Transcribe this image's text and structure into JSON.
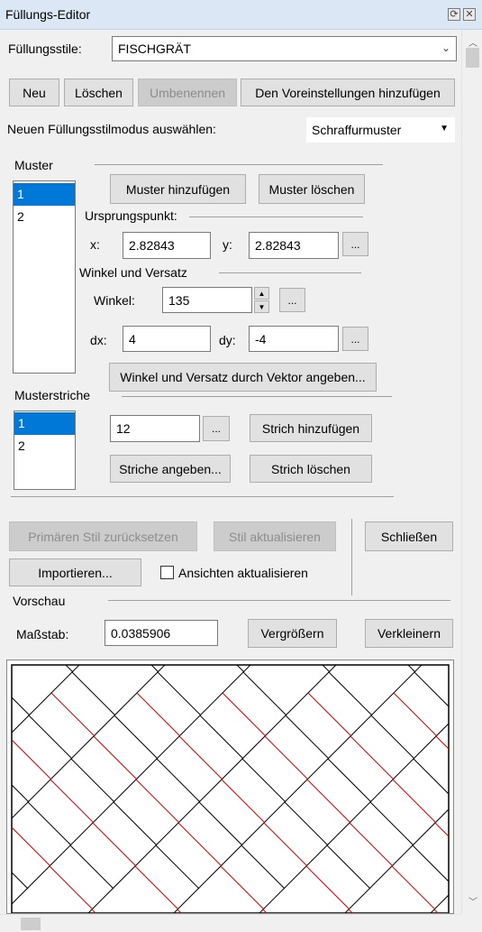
{
  "window": {
    "title": "Füllungs-Editor"
  },
  "fill_styles": {
    "label": "Füllungsstile:",
    "selected": "FISCHGRÄT"
  },
  "actions": {
    "new": "Neu",
    "delete": "Löschen",
    "rename": "Umbenennen",
    "add_preset": "Den Voreinstellungen hinzufügen"
  },
  "mode": {
    "label": "Neuen Füllungsstilmodus auswählen:",
    "selected": "Schraffurmuster"
  },
  "pattern": {
    "heading": "Muster",
    "items": [
      "1",
      "2"
    ],
    "selected_index": 0,
    "add_button": "Muster hinzufügen",
    "delete_button": "Muster löschen",
    "origin_heading": "Ursprungspunkt:",
    "x_label": "x:",
    "x_value": "2.82843",
    "y_label": "y:",
    "y_value": "2.82843",
    "angle_heading": "Winkel und Versatz",
    "angle_label": "Winkel:",
    "angle_value": "135",
    "dx_label": "dx:",
    "dx_value": "4",
    "dy_label": "dy:",
    "dy_value": "-4",
    "vector_button": "Winkel und Versatz durch Vektor angeben...",
    "ellipsis": "..."
  },
  "strokes": {
    "heading": "Musterstriche",
    "items": [
      "1",
      "2"
    ],
    "selected_index": 0,
    "value": "12",
    "add_button": "Strich hinzufügen",
    "specify_button": "Striche angeben...",
    "delete_button": "Strich löschen"
  },
  "bottom": {
    "reset_button": "Primären Stil zurücksetzen",
    "update_button": "Stil aktualisieren",
    "close_button": "Schließen",
    "import_button": "Importieren...",
    "update_views_label": "Ansichten aktualisieren",
    "update_views_checked": false
  },
  "preview": {
    "heading": "Vorschau",
    "scale_label": "Maßstab:",
    "scale_value": "0.0385906",
    "zoom_in": "Vergrößern",
    "zoom_out": "Verkleinern",
    "colors": {
      "line": "#000000",
      "accent": "#cc0000"
    }
  },
  "icons": {
    "pin": "pin-icon",
    "close": "close-icon",
    "dropdown": "chevron-down-icon",
    "spin_up": "spin-up-icon",
    "spin_down": "spin-down-icon"
  }
}
